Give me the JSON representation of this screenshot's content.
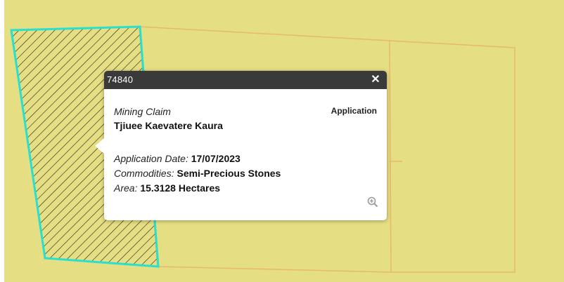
{
  "map": {
    "background_color": "#e6de82",
    "parcel_outline_color": "#e8b96b",
    "selected_outline_color": "#27e0d0"
  },
  "popup": {
    "title": "74840",
    "close_icon": "close-icon",
    "claim_type": "Mining Claim",
    "status": "Application",
    "owner": "Tjiuee Kaevatere Kaura",
    "application_date_label": "Application Date:",
    "application_date_value": "17/07/2023",
    "commodities_label": "Commodities:",
    "commodities_value": "Semi-Precious Stones",
    "area_label": "Area:",
    "area_value": "15.3128",
    "area_unit": "Hectares",
    "zoom_icon": "zoom-in-icon"
  }
}
